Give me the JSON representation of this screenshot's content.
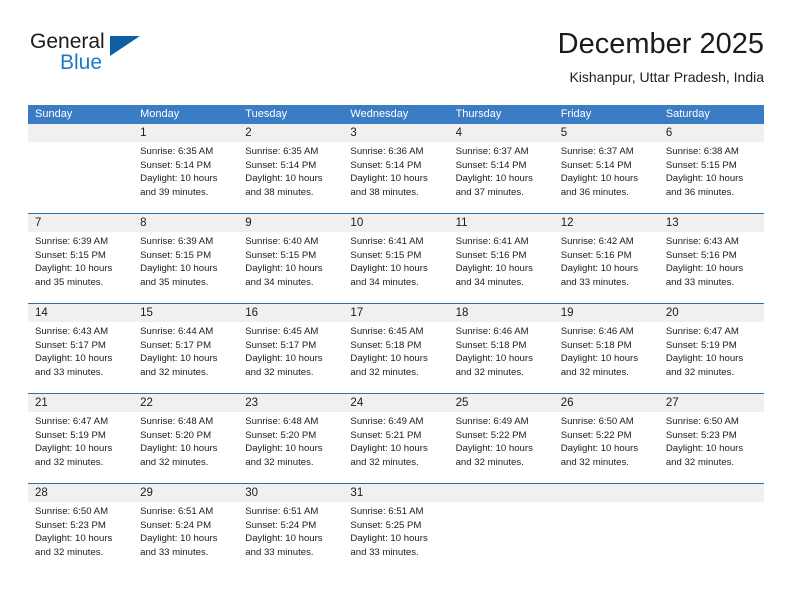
{
  "brand": {
    "name_part1": "General",
    "name_part2": "Blue",
    "triangle_color": "#0e5fa4",
    "blue_text_color": "#1f7ac4"
  },
  "header": {
    "title": "December 2025",
    "location": "Kishanpur, Uttar Pradesh, India"
  },
  "theme": {
    "header_bar_color": "#3b7dc4",
    "week_divider_color": "#2f6fad",
    "day_number_band_color": "#f0f0f0",
    "text_color": "#1c1c1c"
  },
  "day_headers": [
    "Sunday",
    "Monday",
    "Tuesday",
    "Wednesday",
    "Thursday",
    "Friday",
    "Saturday"
  ],
  "weeks": [
    [
      {
        "day": "",
        "lines": []
      },
      {
        "day": "1",
        "lines": [
          "Sunrise: 6:35 AM",
          "Sunset: 5:14 PM",
          "Daylight: 10 hours",
          "and 39 minutes."
        ]
      },
      {
        "day": "2",
        "lines": [
          "Sunrise: 6:35 AM",
          "Sunset: 5:14 PM",
          "Daylight: 10 hours",
          "and 38 minutes."
        ]
      },
      {
        "day": "3",
        "lines": [
          "Sunrise: 6:36 AM",
          "Sunset: 5:14 PM",
          "Daylight: 10 hours",
          "and 38 minutes."
        ]
      },
      {
        "day": "4",
        "lines": [
          "Sunrise: 6:37 AM",
          "Sunset: 5:14 PM",
          "Daylight: 10 hours",
          "and 37 minutes."
        ]
      },
      {
        "day": "5",
        "lines": [
          "Sunrise: 6:37 AM",
          "Sunset: 5:14 PM",
          "Daylight: 10 hours",
          "and 36 minutes."
        ]
      },
      {
        "day": "6",
        "lines": [
          "Sunrise: 6:38 AM",
          "Sunset: 5:15 PM",
          "Daylight: 10 hours",
          "and 36 minutes."
        ]
      }
    ],
    [
      {
        "day": "7",
        "lines": [
          "Sunrise: 6:39 AM",
          "Sunset: 5:15 PM",
          "Daylight: 10 hours",
          "and 35 minutes."
        ]
      },
      {
        "day": "8",
        "lines": [
          "Sunrise: 6:39 AM",
          "Sunset: 5:15 PM",
          "Daylight: 10 hours",
          "and 35 minutes."
        ]
      },
      {
        "day": "9",
        "lines": [
          "Sunrise: 6:40 AM",
          "Sunset: 5:15 PM",
          "Daylight: 10 hours",
          "and 34 minutes."
        ]
      },
      {
        "day": "10",
        "lines": [
          "Sunrise: 6:41 AM",
          "Sunset: 5:15 PM",
          "Daylight: 10 hours",
          "and 34 minutes."
        ]
      },
      {
        "day": "11",
        "lines": [
          "Sunrise: 6:41 AM",
          "Sunset: 5:16 PM",
          "Daylight: 10 hours",
          "and 34 minutes."
        ]
      },
      {
        "day": "12",
        "lines": [
          "Sunrise: 6:42 AM",
          "Sunset: 5:16 PM",
          "Daylight: 10 hours",
          "and 33 minutes."
        ]
      },
      {
        "day": "13",
        "lines": [
          "Sunrise: 6:43 AM",
          "Sunset: 5:16 PM",
          "Daylight: 10 hours",
          "and 33 minutes."
        ]
      }
    ],
    [
      {
        "day": "14",
        "lines": [
          "Sunrise: 6:43 AM",
          "Sunset: 5:17 PM",
          "Daylight: 10 hours",
          "and 33 minutes."
        ]
      },
      {
        "day": "15",
        "lines": [
          "Sunrise: 6:44 AM",
          "Sunset: 5:17 PM",
          "Daylight: 10 hours",
          "and 32 minutes."
        ]
      },
      {
        "day": "16",
        "lines": [
          "Sunrise: 6:45 AM",
          "Sunset: 5:17 PM",
          "Daylight: 10 hours",
          "and 32 minutes."
        ]
      },
      {
        "day": "17",
        "lines": [
          "Sunrise: 6:45 AM",
          "Sunset: 5:18 PM",
          "Daylight: 10 hours",
          "and 32 minutes."
        ]
      },
      {
        "day": "18",
        "lines": [
          "Sunrise: 6:46 AM",
          "Sunset: 5:18 PM",
          "Daylight: 10 hours",
          "and 32 minutes."
        ]
      },
      {
        "day": "19",
        "lines": [
          "Sunrise: 6:46 AM",
          "Sunset: 5:18 PM",
          "Daylight: 10 hours",
          "and 32 minutes."
        ]
      },
      {
        "day": "20",
        "lines": [
          "Sunrise: 6:47 AM",
          "Sunset: 5:19 PM",
          "Daylight: 10 hours",
          "and 32 minutes."
        ]
      }
    ],
    [
      {
        "day": "21",
        "lines": [
          "Sunrise: 6:47 AM",
          "Sunset: 5:19 PM",
          "Daylight: 10 hours",
          "and 32 minutes."
        ]
      },
      {
        "day": "22",
        "lines": [
          "Sunrise: 6:48 AM",
          "Sunset: 5:20 PM",
          "Daylight: 10 hours",
          "and 32 minutes."
        ]
      },
      {
        "day": "23",
        "lines": [
          "Sunrise: 6:48 AM",
          "Sunset: 5:20 PM",
          "Daylight: 10 hours",
          "and 32 minutes."
        ]
      },
      {
        "day": "24",
        "lines": [
          "Sunrise: 6:49 AM",
          "Sunset: 5:21 PM",
          "Daylight: 10 hours",
          "and 32 minutes."
        ]
      },
      {
        "day": "25",
        "lines": [
          "Sunrise: 6:49 AM",
          "Sunset: 5:22 PM",
          "Daylight: 10 hours",
          "and 32 minutes."
        ]
      },
      {
        "day": "26",
        "lines": [
          "Sunrise: 6:50 AM",
          "Sunset: 5:22 PM",
          "Daylight: 10 hours",
          "and 32 minutes."
        ]
      },
      {
        "day": "27",
        "lines": [
          "Sunrise: 6:50 AM",
          "Sunset: 5:23 PM",
          "Daylight: 10 hours",
          "and 32 minutes."
        ]
      }
    ],
    [
      {
        "day": "28",
        "lines": [
          "Sunrise: 6:50 AM",
          "Sunset: 5:23 PM",
          "Daylight: 10 hours",
          "and 32 minutes."
        ]
      },
      {
        "day": "29",
        "lines": [
          "Sunrise: 6:51 AM",
          "Sunset: 5:24 PM",
          "Daylight: 10 hours",
          "and 33 minutes."
        ]
      },
      {
        "day": "30",
        "lines": [
          "Sunrise: 6:51 AM",
          "Sunset: 5:24 PM",
          "Daylight: 10 hours",
          "and 33 minutes."
        ]
      },
      {
        "day": "31",
        "lines": [
          "Sunrise: 6:51 AM",
          "Sunset: 5:25 PM",
          "Daylight: 10 hours",
          "and 33 minutes."
        ]
      },
      {
        "day": "",
        "lines": []
      },
      {
        "day": "",
        "lines": []
      },
      {
        "day": "",
        "lines": []
      }
    ]
  ]
}
